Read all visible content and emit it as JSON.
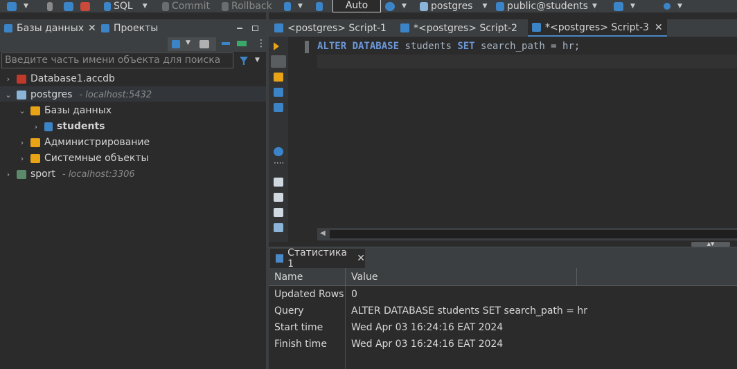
{
  "toolbar": {
    "sql_label": "SQL",
    "commit_label": "Commit",
    "rollback_label": "Rollback",
    "transaction_mode": "Auto",
    "connection_label": "postgres",
    "schema_label": "public@students"
  },
  "left_panel": {
    "tabs": [
      {
        "label": "Базы данных",
        "close": "✕"
      },
      {
        "label": "Проекты"
      }
    ],
    "search_placeholder": "Введите часть имени объекта для поиска",
    "tree": [
      {
        "label": "Database1.accdb",
        "host": "",
        "chevron": "›"
      },
      {
        "label": "postgres",
        "host": "- localhost:5432",
        "chevron": "⌄"
      },
      {
        "label": "Базы данных",
        "host": "",
        "chevron": "⌄"
      },
      {
        "label": "students",
        "host": "",
        "chevron": "›"
      },
      {
        "label": "Администрирование",
        "host": "",
        "chevron": "›"
      },
      {
        "label": "Системные объекты",
        "host": "",
        "chevron": "›"
      },
      {
        "label": "sport",
        "host": "- localhost:3306",
        "chevron": "›"
      }
    ]
  },
  "editor": {
    "tabs": [
      {
        "label": "<postgres> Script-1"
      },
      {
        "label": "*<postgres> Script-2"
      },
      {
        "label": "*<postgres> Script-3",
        "close": "✕"
      }
    ],
    "code": {
      "kw1": "ALTER DATABASE",
      "t1": " students ",
      "kw2": "SET",
      "t2": " search_path = hr;"
    }
  },
  "results": {
    "tab_label": "Статистика 1",
    "tab_close": "✕",
    "columns": [
      "Name",
      "Value"
    ],
    "rows": [
      {
        "name": "Updated Rows",
        "value": "0"
      },
      {
        "name": "Query",
        "value": "ALTER DATABASE students SET search_path = hr"
      },
      {
        "name": "Start time",
        "value": "Wed Apr 03 16:24:16 EAT 2024"
      },
      {
        "name": "Finish time",
        "value": "Wed Apr 03 16:24:16 EAT 2024"
      }
    ]
  },
  "colors": {
    "accent_blue": "#4a88c7",
    "keyword": "#6b97d9",
    "toolbar_bg": "#3c3f41",
    "editor_bg": "#2b2b2b"
  }
}
